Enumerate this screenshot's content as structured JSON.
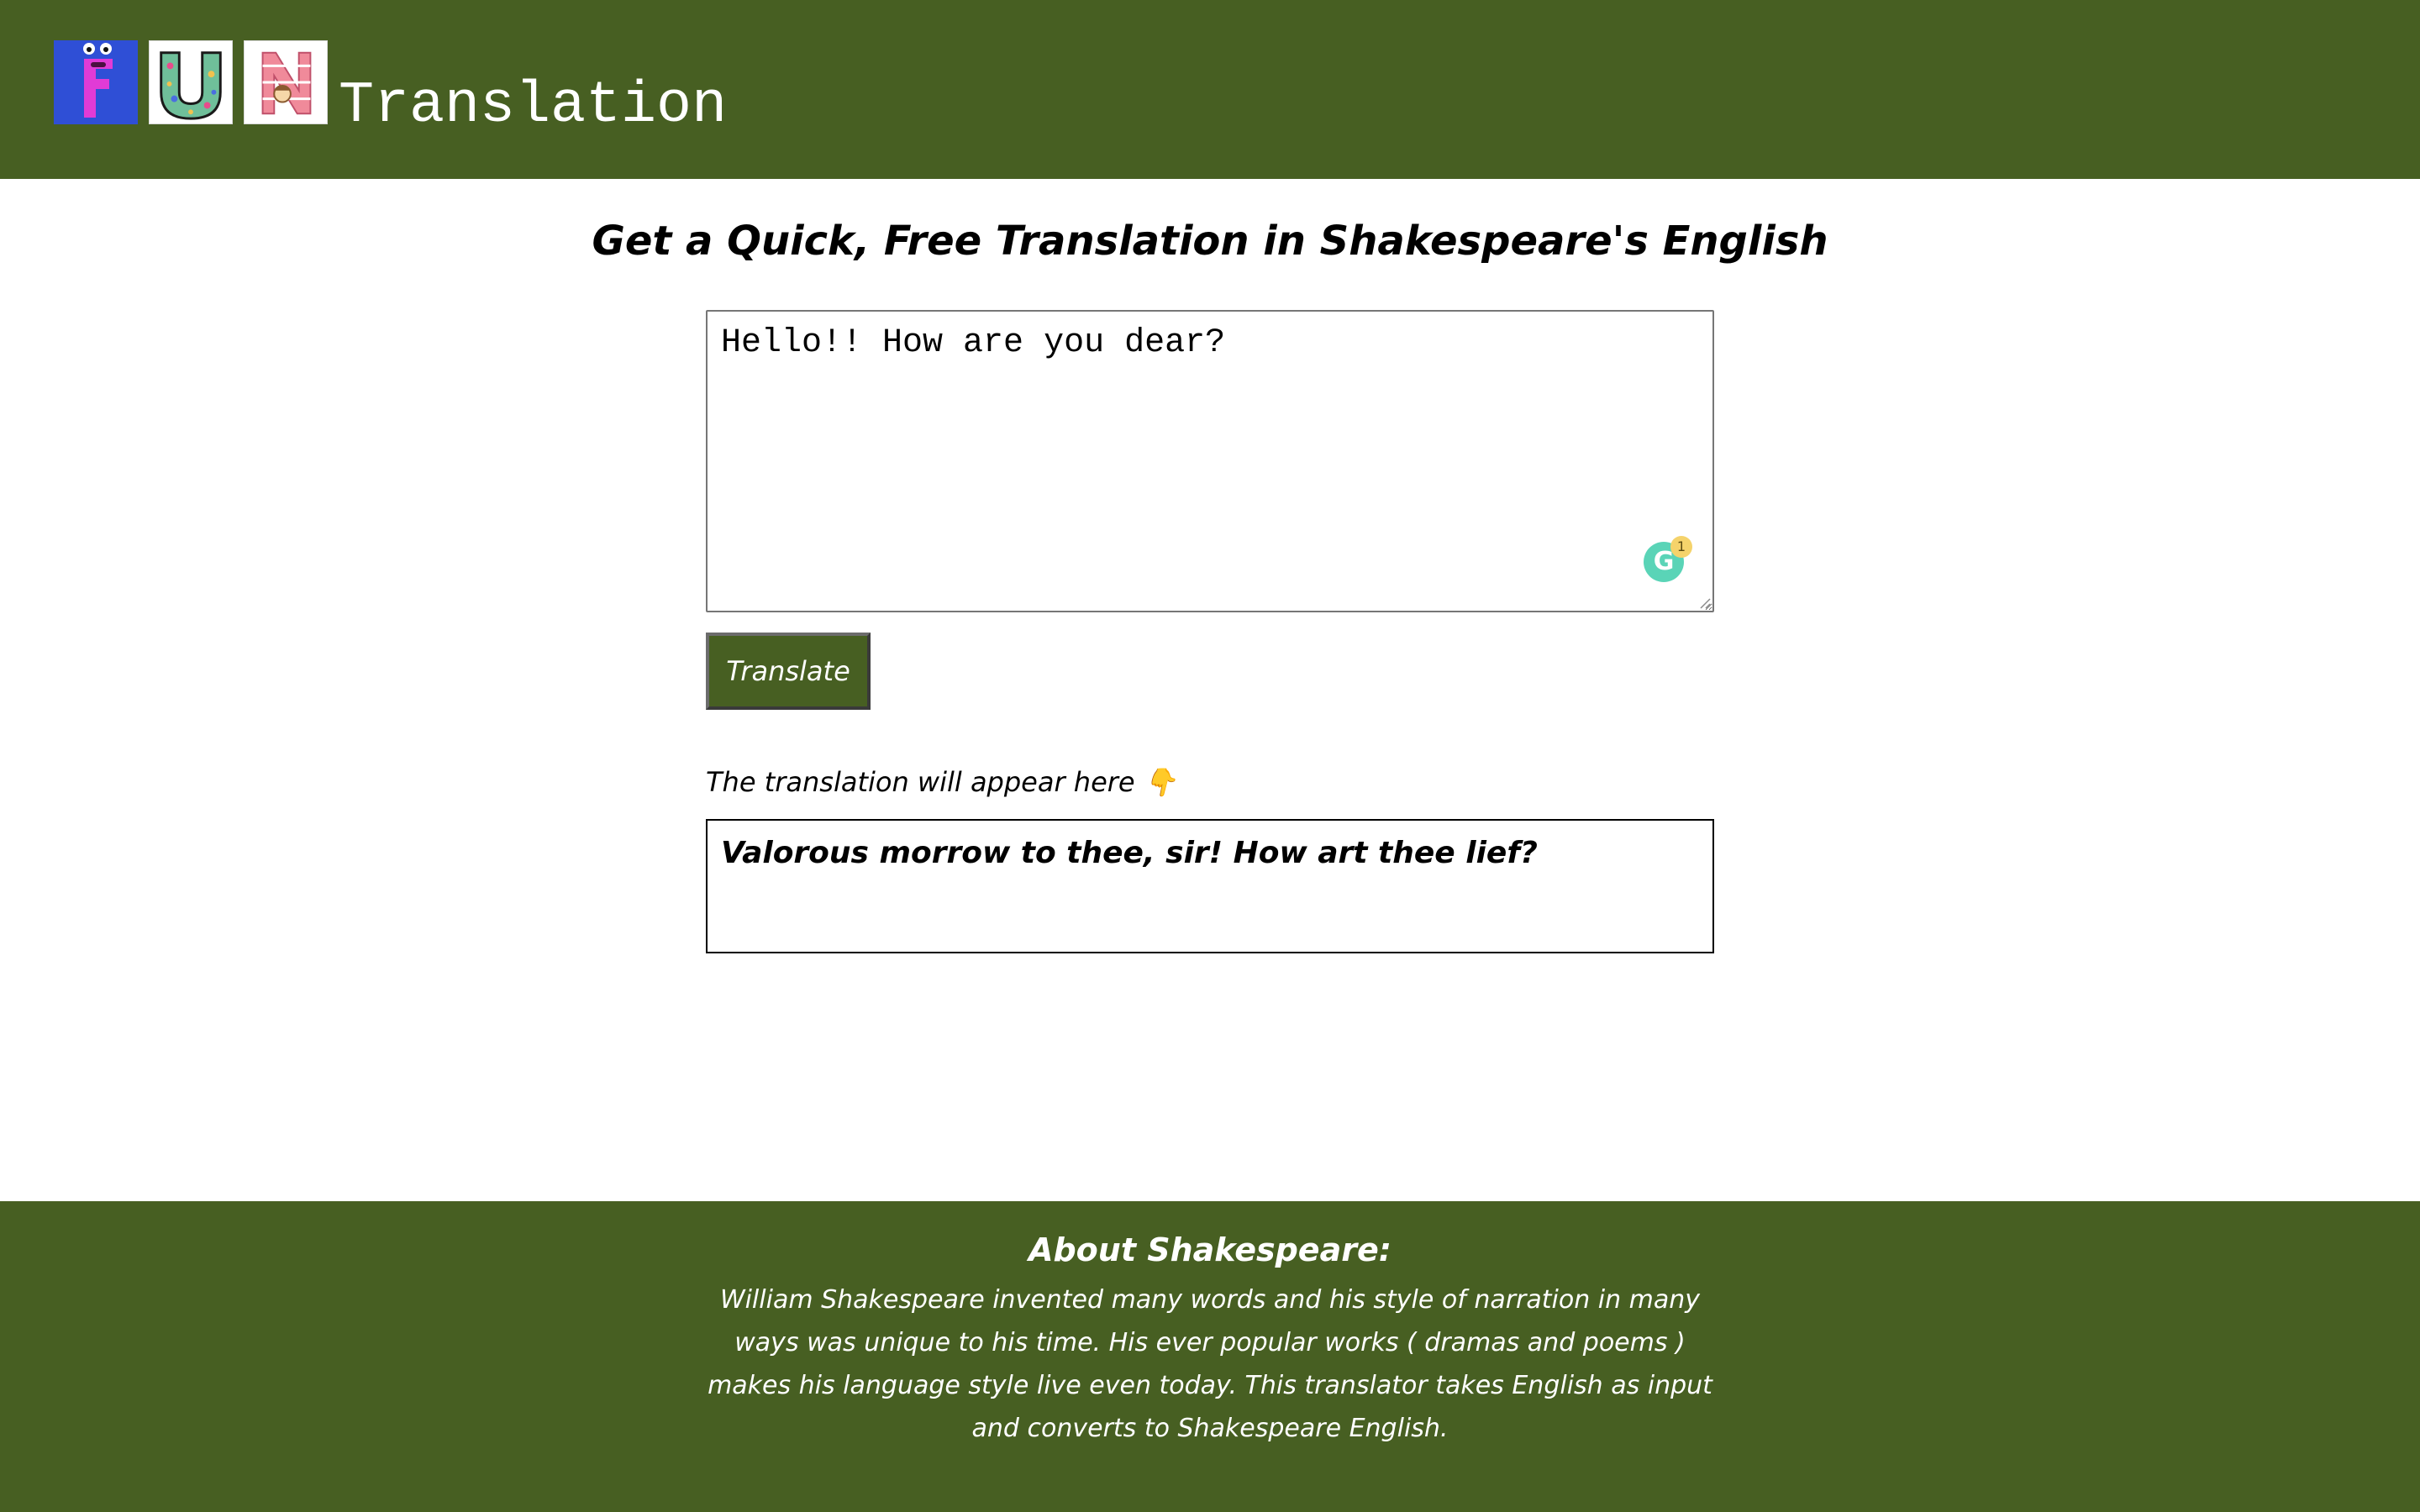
{
  "header": {
    "logo_letters": [
      "F",
      "U",
      "N"
    ],
    "brand_text": "Translation",
    "background_color": "#475f22"
  },
  "main": {
    "title": "Get a Quick, Free Translation in Shakespeare's English",
    "input": {
      "value": "Hello!! How are you dear?"
    },
    "grammarly_badge": {
      "icon": "grammarly-icon",
      "letter": "G",
      "count": "1"
    },
    "translate_button_label": "Translate",
    "output_label": "The translation will appear here 👇",
    "output_text": "Valorous morrow to thee, sir! How art thee lief?"
  },
  "footer": {
    "title": "About Shakespeare:",
    "text": "William Shakespeare invented many words and his style of narration in many ways was unique to his time. His ever popular works ( dramas and poems ) makes his language style live even today. This translator takes English as input and converts to Shakespeare English."
  },
  "colors": {
    "accent": "#475f22",
    "logo_f_bg": "#2f4fd6",
    "grammarly": "#15c39a"
  }
}
